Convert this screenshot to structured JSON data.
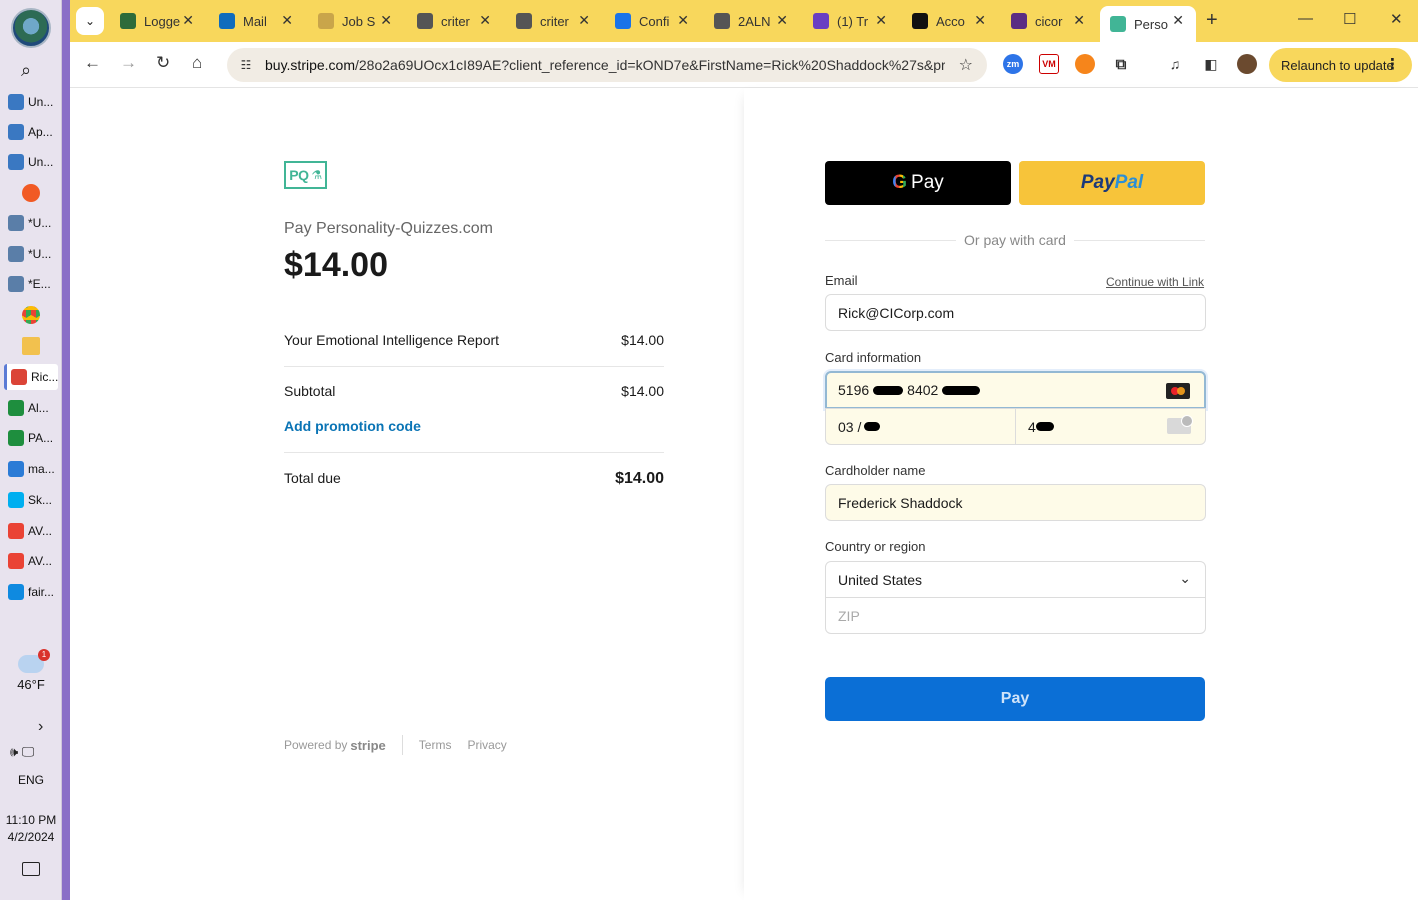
{
  "taskbar": {
    "items": [
      {
        "label": "Un...",
        "color": "#3a78c2"
      },
      {
        "label": "Ap...",
        "color": "#3a78c2"
      },
      {
        "label": "Un...",
        "color": "#3a78c2"
      },
      {
        "label": "*U...",
        "color": "#5a7ea8"
      },
      {
        "label": "*U...",
        "color": "#5a7ea8"
      },
      {
        "label": "*E...",
        "color": "#5a7ea8"
      },
      {
        "label": "Ric...",
        "color": "#db4437"
      },
      {
        "label": "Al...",
        "color": "#1e8e3e"
      },
      {
        "label": "PA...",
        "color": "#1e8e3e"
      },
      {
        "label": "ma...",
        "color": "#2b7bd6"
      },
      {
        "label": "Sk...",
        "color": "#00aff0"
      },
      {
        "label": "AV...",
        "color": "#ea4335"
      },
      {
        "label": "AV...",
        "color": "#ea4335"
      },
      {
        "label": "fair...",
        "color": "#0f8ae0"
      }
    ],
    "weather_temp": "46°F",
    "weather_badge": "1",
    "language": "ENG",
    "time": "11:10 PM",
    "date": "4/2/2024"
  },
  "browser": {
    "tabs": [
      {
        "title": "Logge",
        "fav_color": "#2e6b3a"
      },
      {
        "title": "Mail",
        "fav_color": "#0f6cbd"
      },
      {
        "title": "Job S",
        "fav_color": "#c9a54a"
      },
      {
        "title": "criter",
        "fav_color": "#555555"
      },
      {
        "title": "criter",
        "fav_color": "#555555"
      },
      {
        "title": "Confi",
        "fav_color": "#1a73e8"
      },
      {
        "title": "2ALN",
        "fav_color": "#555555"
      },
      {
        "title": "(1) Tr",
        "fav_color": "#6a3fc2"
      },
      {
        "title": "Acco",
        "fav_color": "#111111"
      },
      {
        "title": "cicor",
        "fav_color": "#5b2d83"
      },
      {
        "title": "Perso",
        "fav_color": "#41b596"
      }
    ],
    "url_domain": "buy.stripe.com",
    "url_path": "/28o2a69UOcx1cI89AE?client_reference_id=kOND7e&FirstName=Rick%20Shaddock%27s&pre...",
    "relaunch_label": "Relaunch to update"
  },
  "checkout": {
    "logo_text": "PQ",
    "pay_to": "Pay Personality-Quizzes.com",
    "amount": "$14.00",
    "item_name": "Your Emotional Intelligence Report",
    "item_price": "$14.00",
    "subtotal_label": "Subtotal",
    "subtotal_value": "$14.00",
    "promo_label": "Add promotion code",
    "total_label": "Total due",
    "total_value": "$14.00",
    "footer_powered": "Powered by",
    "footer_brand": "stripe",
    "footer_terms": "Terms",
    "footer_privacy": "Privacy"
  },
  "payment": {
    "gpay_label": "Pay",
    "gpay_g": "G",
    "paypal_p1": "Pay",
    "paypal_p2": "Pal",
    "or_label": "Or pay with card",
    "email_label": "Email",
    "continue_link": "Continue with Link",
    "email_value": "Rick@CICorp.com",
    "card_label": "Card information",
    "card_part1": "5196",
    "card_part2": "8402",
    "exp_prefix": "03 /",
    "cvc_prefix": "4",
    "cardholder_label": "Cardholder name",
    "cardholder_value": "Frederick Shaddock",
    "country_label": "Country or region",
    "country_value": "United States",
    "zip_placeholder": "ZIP",
    "pay_button": "Pay"
  }
}
